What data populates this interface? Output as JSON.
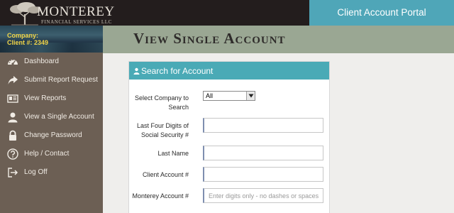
{
  "header": {
    "logo_name": "MONTEREY",
    "logo_sub": "FINANCIAL SERVICES LLC",
    "portal_title": "Client Account Portal"
  },
  "page": {
    "title": "View Single Account"
  },
  "sidebar": {
    "company_label": "Company:",
    "client_label": "Client #: 2349",
    "items": [
      {
        "label": "Dashboard",
        "icon": "dashboard-icon"
      },
      {
        "label": "Submit Report Request",
        "icon": "share-arrow-icon"
      },
      {
        "label": "View Reports",
        "icon": "report-card-icon"
      },
      {
        "label": "View a Single Account",
        "icon": "user-icon"
      },
      {
        "label": "Change Password",
        "icon": "lock-icon"
      },
      {
        "label": "Help / Contact",
        "icon": "question-circle-icon"
      },
      {
        "label": "Log Off",
        "icon": "sign-out-icon"
      }
    ]
  },
  "search_panel": {
    "title": "Search for Account",
    "company_select": {
      "label": "Select Company to Search",
      "value": "All"
    },
    "last_four": {
      "label": "Last Four Digits of Social Security #",
      "value": "",
      "placeholder": ""
    },
    "last_name": {
      "label": "Last Name",
      "value": "",
      "placeholder": ""
    },
    "client_account": {
      "label": "Client Account #",
      "value": "",
      "placeholder": ""
    },
    "monterey_account": {
      "label": "Monterey Account #",
      "value": "",
      "placeholder": "Enter digits only - no dashes or spaces"
    }
  },
  "colors": {
    "accent_teal": "#4aaab6",
    "sidebar_brown": "#6c5f54",
    "title_band": "#9aa793",
    "company_yellow": "#f2d648"
  }
}
